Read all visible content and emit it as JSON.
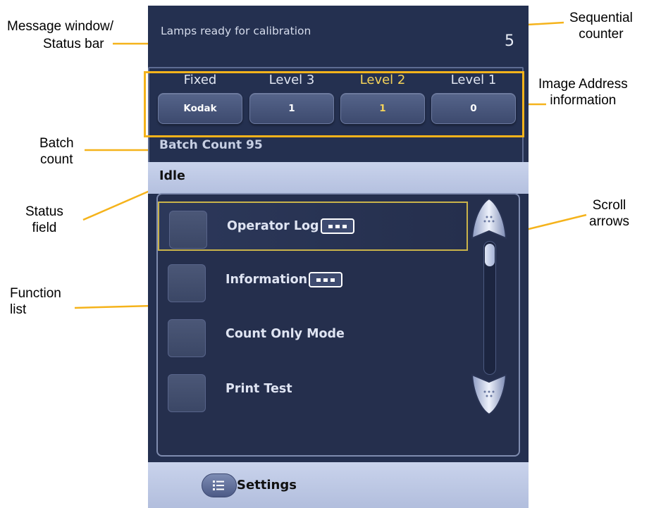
{
  "callouts": {
    "message_window": "Message window/",
    "status_bar": "Status bar",
    "sequential": "Sequential",
    "counter": "counter",
    "image_address": "Image Address",
    "information": "information",
    "batch": "Batch",
    "count": "count",
    "status": "Status",
    "field": "field",
    "scroll": "Scroll",
    "arrows": "arrows",
    "function": "Function",
    "list": "list"
  },
  "status_message": "Lamps ready for calibration",
  "sequential_counter": "5",
  "image_address": [
    {
      "label": "Fixed",
      "value": "Kodak",
      "active": false
    },
    {
      "label": "Level 3",
      "value": "1",
      "active": false
    },
    {
      "label": "Level 2",
      "value": "1",
      "active": true
    },
    {
      "label": "Level 1",
      "value": "0",
      "active": false
    }
  ],
  "batch_count": "Batch Count 95",
  "status_field": "Idle",
  "functions": [
    {
      "label": "Operator Log",
      "has_more_icon": true,
      "selected": true
    },
    {
      "label": "Information",
      "has_more_icon": true,
      "selected": false
    },
    {
      "label": "Count Only Mode",
      "has_more_icon": false,
      "selected": false
    },
    {
      "label": "Print Test",
      "has_more_icon": false,
      "selected": false
    }
  ],
  "settings_label": "Settings",
  "colors": {
    "panel_bg": "#243050",
    "highlight": "#f5b31b",
    "active_text": "#f5d35a",
    "bar_bg": "#c1ccea"
  },
  "icons": [
    "scroll-up-arrow-icon",
    "scroll-down-arrow-icon",
    "more-options-icon",
    "settings-list-icon"
  ]
}
